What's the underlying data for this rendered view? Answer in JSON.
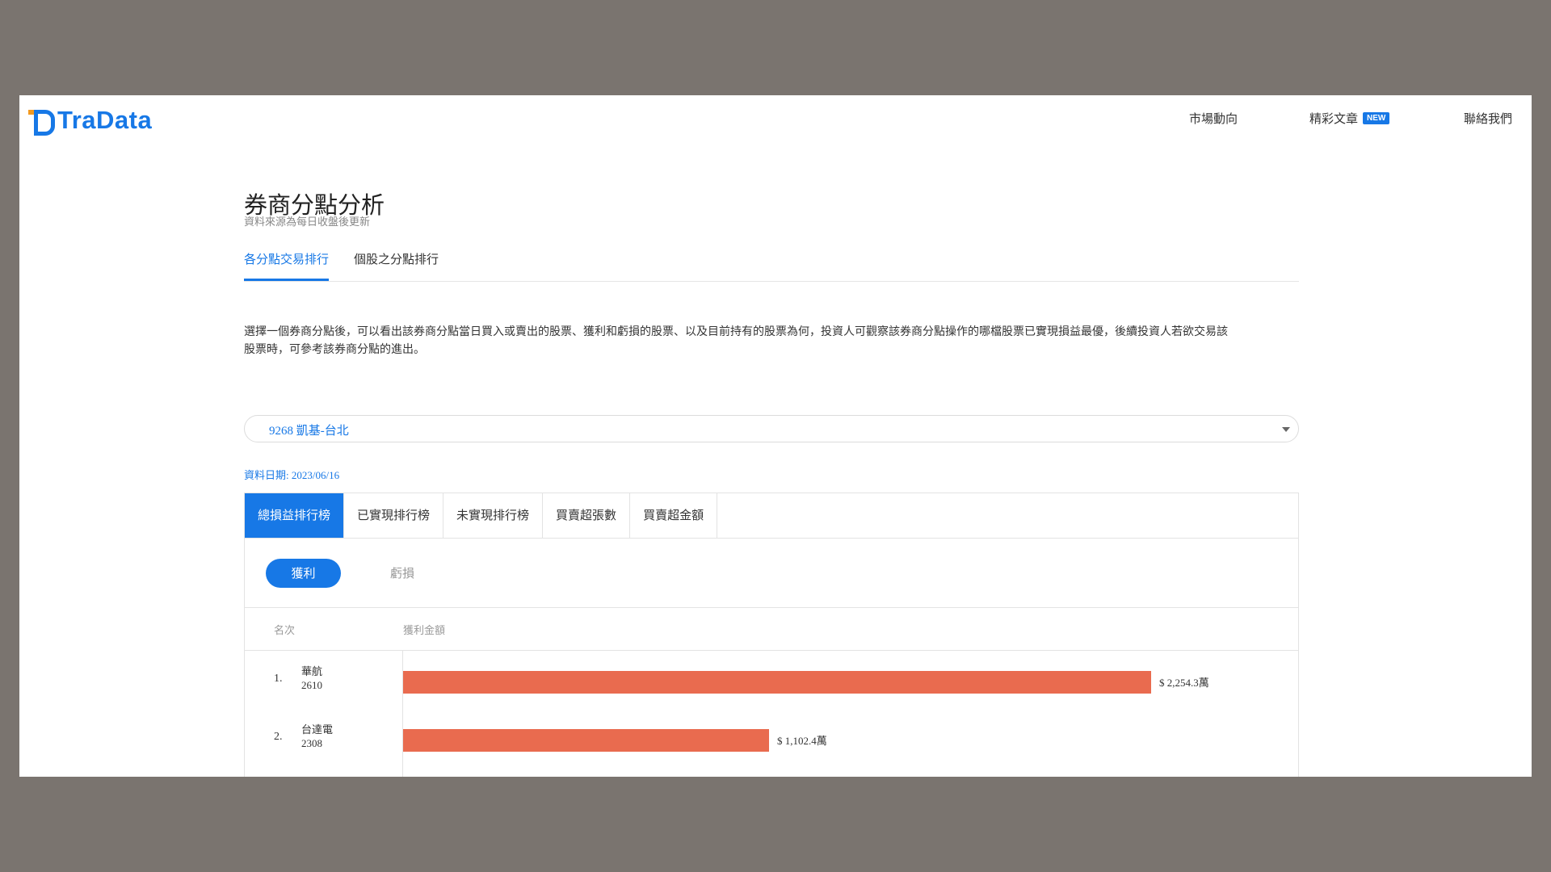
{
  "header": {
    "logo_text": "TraData",
    "nav": {
      "market": "市場動向",
      "articles": "精彩文章",
      "articles_badge": "NEW",
      "contact": "聯絡我們"
    },
    "colors": {
      "brand": "#1778e6",
      "logo_accent": "#f39a1f"
    }
  },
  "page": {
    "title": "券商分點分析",
    "subtitle": "資料來源為每日收盤後更新",
    "tabs": [
      {
        "label": "各分點交易排行",
        "active": true
      },
      {
        "label": "個股之分點排行",
        "active": false
      }
    ],
    "description_line1": "選擇一個券商分點後，可以看出該券商分點當日買入或賣出的股票、獲利和虧損的股票、以及目前持有的股票為何，投資人可觀察該券商分點操作的哪檔股票已實現損益最優，後續投資人若欲交易該",
    "description_line2": "股票時，可參考該券商分點的進出。"
  },
  "broker_select": {
    "value": "9268 凱基-台北"
  },
  "data_date": "資料日期: 2023/06/16",
  "ranking_tabs": [
    {
      "label": "總損益排行榜",
      "active": true
    },
    {
      "label": "已實現排行榜",
      "active": false
    },
    {
      "label": "未實現排行榜",
      "active": false
    },
    {
      "label": "買賣超張數",
      "active": false
    },
    {
      "label": "買賣超金額",
      "active": false
    }
  ],
  "pl_toggle": {
    "profit": "獲利",
    "loss": "虧損",
    "selected": "profit"
  },
  "table": {
    "col_rank": "名次",
    "col_amount": "獲利金額",
    "bar_color": "#e96b4f",
    "max_value": 2254.3,
    "rows": [
      {
        "rank": "1.",
        "name": "華航",
        "code": "2610",
        "value": 2254.3,
        "label": "$ 2,254.3萬"
      },
      {
        "rank": "2.",
        "name": "台達電",
        "code": "2308",
        "value": 1102.4,
        "label": "$ 1,102.4萬"
      }
    ]
  }
}
